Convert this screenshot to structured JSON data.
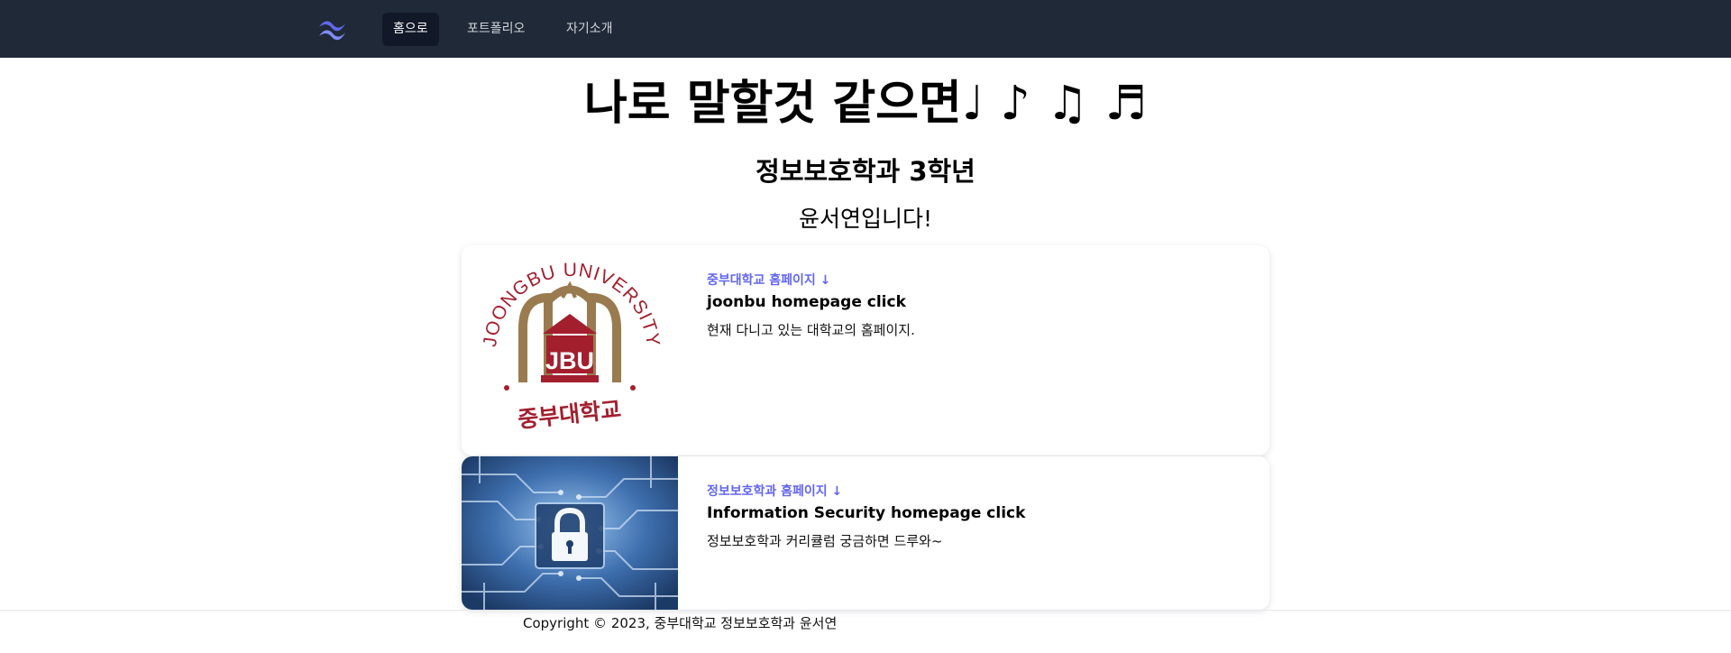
{
  "nav": {
    "logo_icon": "tailwind-logo-icon",
    "items": [
      {
        "label": "홈으로",
        "active": true
      },
      {
        "label": "포트폴리오",
        "active": false
      },
      {
        "label": "자기소개",
        "active": false
      }
    ]
  },
  "hero": {
    "title": "나로 말할것 같으면♩ ♪ ♫ ♬",
    "subtitle": "정보보호학과 3학년",
    "intro": "윤서연입니다!"
  },
  "cards": [
    {
      "link_label": "중부대학교 홈페이지 ↓",
      "title": "joonbu homepage click",
      "description": "현재 다니고 있는 대학교의 홈페이지.",
      "image": {
        "icon": "joongbu-university-seal",
        "arc_text": "JOONGBU UNIVERSITY",
        "emblem_text": "JBU",
        "korean_text": "중부대학교"
      }
    },
    {
      "link_label": "정보보호학과 홈페이지 ↓",
      "title": "Information Security homepage click",
      "description": "정보보호학과 커리큘럼 궁금하면 드루와~",
      "image": {
        "icon": "circuit-padlock-icon"
      }
    }
  ],
  "footer": {
    "copyright": "Copyright © 2023, 중부대학교 정보보호학과 윤서연"
  },
  "colors": {
    "nav_bg": "#1f2937",
    "nav_active_bg": "#111827",
    "accent": "#6366f1",
    "seal_red": "#a31f2e",
    "seal_gold": "#9a7b4f",
    "circuit_blue": "#2f5f9a"
  }
}
